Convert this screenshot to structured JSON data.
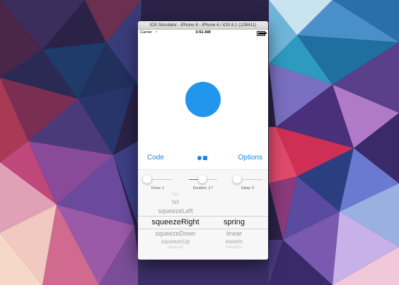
{
  "window": {
    "title": "iOS Simulator - iPhone 6 - iPhone 6 / iOS 8.1 (12B411)"
  },
  "statusbar": {
    "carrier": "Carrier",
    "wifi_icon": "wifi-icon",
    "time": "3:51 AM",
    "battery_icon": "battery-icon"
  },
  "colors": {
    "accent": "#1a84e0",
    "ball": "#2196ec"
  },
  "controls": {
    "code_label": "Code",
    "options_label": "Options",
    "center_icon": "shapes-icon"
  },
  "sliders": [
    {
      "label": "Force: 1",
      "value_fraction": 0.05
    },
    {
      "label": "Duration: 2.7",
      "value_fraction": 0.5
    },
    {
      "label": "Delay: 0",
      "value_fraction": 0.0
    }
  ],
  "picker": {
    "animation": [
      "fury",
      "fall",
      "squeezeLeft",
      "squeezeRight",
      "squeezeDown",
      "squeezeUp",
      "slideLeft"
    ],
    "animation_selected": "squeezeRight",
    "curve": [
      "spring",
      "linear",
      "easeIn",
      "easeOut"
    ],
    "curve_selected": "spring"
  }
}
